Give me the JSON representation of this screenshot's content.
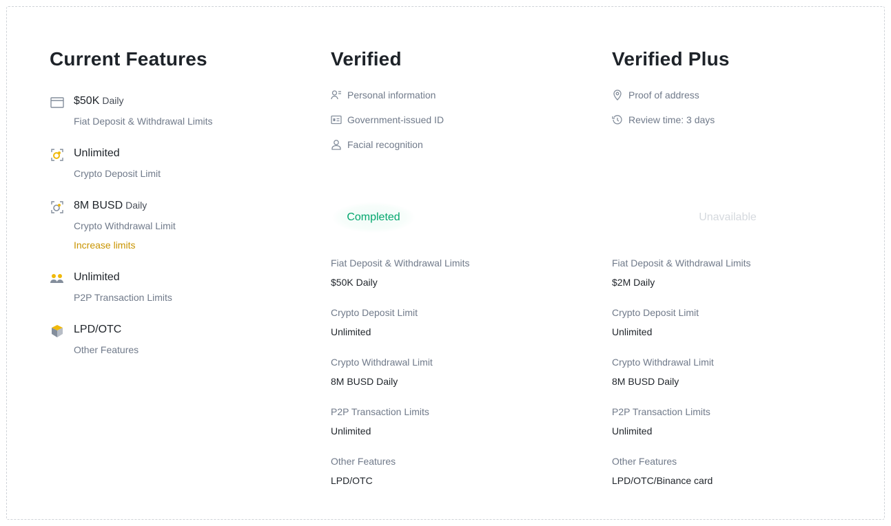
{
  "current": {
    "title": "Current Features",
    "features": [
      {
        "value": "$50K",
        "unit": "Daily",
        "label": "Fiat Deposit & Withdrawal Limits",
        "icon": "card-icon"
      },
      {
        "value": "Unlimited",
        "unit": "",
        "label": "Crypto Deposit Limit",
        "icon": "crypto-deposit-icon"
      },
      {
        "value": "8M BUSD",
        "unit": "Daily",
        "label": "Crypto Withdrawal Limit",
        "icon": "crypto-withdraw-icon",
        "link": "Increase limits"
      },
      {
        "value": "Unlimited",
        "unit": "",
        "label": "P2P Transaction Limits",
        "icon": "p2p-users-icon"
      },
      {
        "value": "LPD/OTC",
        "unit": "",
        "label": "Other Features",
        "icon": "cube-icon"
      }
    ]
  },
  "verified": {
    "title": "Verified",
    "requirements": [
      {
        "text": "Personal information",
        "icon": "person-info-icon"
      },
      {
        "text": "Government-issued ID",
        "icon": "id-card-icon"
      },
      {
        "text": "Facial recognition",
        "icon": "face-user-icon"
      }
    ],
    "status": "Completed",
    "limits": [
      {
        "label": "Fiat Deposit & Withdrawal Limits",
        "value": "$50K Daily"
      },
      {
        "label": "Crypto Deposit Limit",
        "value": "Unlimited"
      },
      {
        "label": "Crypto Withdrawal Limit",
        "value": "8M BUSD Daily"
      },
      {
        "label": "P2P Transaction Limits",
        "value": "Unlimited"
      },
      {
        "label": "Other Features",
        "value": "LPD/OTC"
      }
    ]
  },
  "verified_plus": {
    "title": "Verified Plus",
    "requirements": [
      {
        "text": "Proof of address",
        "icon": "location-pin-icon"
      },
      {
        "text": "Review time: 3 days",
        "icon": "clock-history-icon"
      }
    ],
    "status": "Unavailable",
    "limits": [
      {
        "label": "Fiat Deposit & Withdrawal Limits",
        "value": "$2M Daily"
      },
      {
        "label": "Crypto Deposit Limit",
        "value": "Unlimited"
      },
      {
        "label": "Crypto Withdrawal Limit",
        "value": "8M BUSD Daily"
      },
      {
        "label": "P2P Transaction Limits",
        "value": "Unlimited"
      },
      {
        "label": "Other Features",
        "value": "LPD/OTC/Binance card"
      }
    ]
  },
  "colors": {
    "accent_yellow": "#F0B90B",
    "link_gold": "#C99400",
    "success_green": "#03A66D",
    "text_primary": "#1E2329",
    "text_secondary": "#707A8A",
    "disabled": "#D5D9DE"
  }
}
